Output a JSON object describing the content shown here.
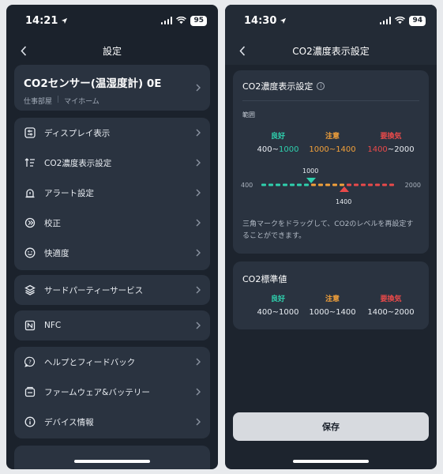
{
  "left": {
    "status": {
      "time": "14:21",
      "battery": "95"
    },
    "nav": {
      "title": "設定"
    },
    "device": {
      "name": "CO2センサー(温湿度計) 0E",
      "room": "仕事部屋",
      "home": "マイホーム"
    },
    "group1": [
      {
        "icon": "display-icon",
        "label": "ディスプレイ表示"
      },
      {
        "icon": "sort-icon",
        "label": "CO2濃度表示設定"
      },
      {
        "icon": "alert-icon",
        "label": "アラート設定"
      },
      {
        "icon": "calibrate-icon",
        "label": "校正"
      },
      {
        "icon": "smile-icon",
        "label": "快適度"
      }
    ],
    "group2": {
      "icon": "layers-icon",
      "label": "サードパーティーサービス"
    },
    "group3": {
      "icon": "nfc-icon",
      "label": "NFC"
    },
    "group4": [
      {
        "icon": "help-icon",
        "label": "ヘルプとフィードバック"
      },
      {
        "icon": "firmware-icon",
        "label": "ファームウェア&バッテリー"
      },
      {
        "icon": "info-icon",
        "label": "デバイス情報"
      }
    ]
  },
  "right": {
    "status": {
      "time": "14:30",
      "battery": "94"
    },
    "nav": {
      "title": "CO2濃度表示設定"
    },
    "display_card": {
      "title": "CO2濃度表示設定",
      "range_label": "範囲",
      "levels": [
        {
          "name": "良好",
          "range_start": "400",
          "range_sep": "~",
          "range_end": "1000",
          "color": "#2fd1ae"
        },
        {
          "name": "注意",
          "range_start": "1000",
          "range_sep": "~",
          "range_end": "1400",
          "color": "#f3a13a"
        },
        {
          "name": "要換気",
          "range_start": "1400",
          "range_sep": "~",
          "range_end": "2000",
          "color": "#ea4a4a"
        }
      ],
      "slider": {
        "min": "400",
        "max": "2000",
        "low_marker": "1000",
        "high_marker": "1400",
        "min_value": 400,
        "max_value": 2000,
        "low_value": 1000,
        "high_value": 1400
      },
      "note": "三角マークをドラッグして、CO2のレベルを再設定することができます。"
    },
    "standard_card": {
      "title": "CO2標準値",
      "levels": [
        {
          "name": "良好",
          "range": "400~1000"
        },
        {
          "name": "注意",
          "range": "1000~1400"
        },
        {
          "name": "要換気",
          "range": "1400~2000"
        }
      ]
    },
    "save_label": "保存"
  },
  "colors": {
    "good": "#2fd1ae",
    "caution": "#f3a13a",
    "ventilate": "#ea4a4a",
    "card": "#2a3340",
    "background": "#1b222c"
  }
}
